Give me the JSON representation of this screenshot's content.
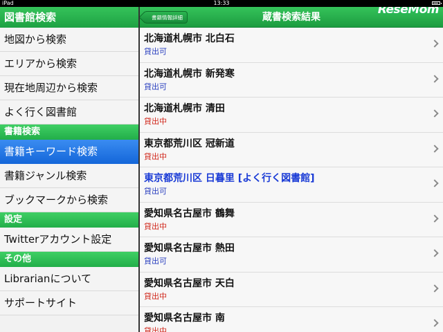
{
  "status_bar": {
    "carrier": "iPad",
    "time": "13:33",
    "battery_level": 0.85
  },
  "sidebar": {
    "title": "図書館検索",
    "items_top": [
      {
        "label": "地図から検索"
      },
      {
        "label": "エリアから検索"
      },
      {
        "label": "現在地周辺から検索"
      },
      {
        "label": "よく行く図書館"
      }
    ],
    "section_books": "書籍検索",
    "items_books": [
      {
        "label": "書籍キーワード検索"
      },
      {
        "label": "書籍ジャンル検索"
      },
      {
        "label": "ブックマークから検索"
      }
    ],
    "section_settings": "設定",
    "items_settings": [
      {
        "label": "Twitterアカウント設定"
      }
    ],
    "section_other": "その他",
    "items_other": [
      {
        "label": "Librarianについて"
      },
      {
        "label": "サポートサイト"
      }
    ]
  },
  "navbar": {
    "back_label": "書籍情報詳細",
    "title": "蔵書検索結果",
    "watermark": "ReseMom"
  },
  "results": [
    {
      "name": "北海道札幌市 北白石",
      "status": "貸出可"
    },
    {
      "name": "北海道札幌市 新発寒",
      "status": "貸出可"
    },
    {
      "name": "北海道札幌市 清田",
      "status": "貸出中"
    },
    {
      "name": "東京都荒川区 冠新道",
      "status": "貸出中"
    },
    {
      "name": "東京都荒川区 日暮里 [よく行く図書館]",
      "status": "貸出可"
    },
    {
      "name": "愛知県名古屋市 鶴舞",
      "status": "貸出中"
    },
    {
      "name": "愛知県名古屋市 熱田",
      "status": "貸出可"
    },
    {
      "name": "愛知県名古屋市 天白",
      "status": "貸出中"
    },
    {
      "name": "愛知県名古屋市 南",
      "status": "貸出中"
    }
  ],
  "colors": {
    "accent_green": "#22ae49",
    "selected_blue": "#1466d9",
    "available_blue": "#2a3fbf",
    "checked_out_red": "#d0261a",
    "favorite_blue": "#1a3bd6"
  }
}
